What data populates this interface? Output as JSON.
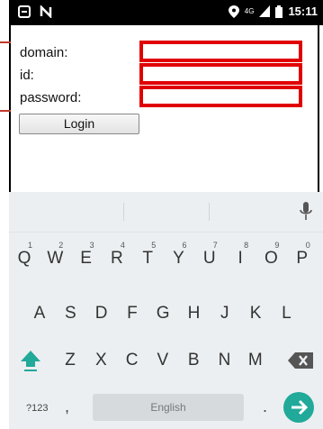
{
  "status": {
    "network": "4G",
    "time": "15:11"
  },
  "form": {
    "domain_label": "domain:",
    "id_label": "id:",
    "password_label": "password:",
    "domain_value": "",
    "id_value": "",
    "password_value": "",
    "login_label": "Login"
  },
  "keyboard": {
    "row1": [
      "Q",
      "W",
      "E",
      "R",
      "T",
      "Y",
      "U",
      "I",
      "O",
      "P"
    ],
    "row1_hints": [
      "1",
      "2",
      "3",
      "4",
      "5",
      "6",
      "7",
      "8",
      "9",
      "0"
    ],
    "row2": [
      "A",
      "S",
      "D",
      "F",
      "G",
      "H",
      "J",
      "K",
      "L"
    ],
    "row3": [
      "Z",
      "X",
      "C",
      "V",
      "B",
      "N",
      "M"
    ],
    "symbols_label": "?123",
    "comma": ",",
    "period": ".",
    "space_label": "English"
  },
  "colors": {
    "highlight": "#e00000",
    "enter": "#21a99a",
    "shift": "#21a99a"
  }
}
